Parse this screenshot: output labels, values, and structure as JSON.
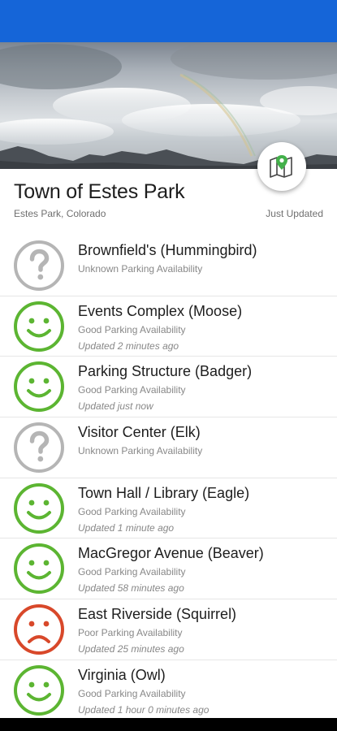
{
  "colors": {
    "status_bar": "#1565d8",
    "good": "#5cb532",
    "poor": "#d8482a",
    "unknown": "#b5b5b5",
    "map_pin": "#43b04a"
  },
  "header": {
    "title": "Town of Estes Park",
    "location": "Estes Park, Colorado",
    "updated": "Just Updated"
  },
  "map_button": {
    "icon": "map-pin-icon"
  },
  "lots": [
    {
      "name": "Brownfield's (Hummingbird)",
      "status": "Unknown Parking Availability",
      "updated": "",
      "state": "unknown"
    },
    {
      "name": "Events Complex (Moose)",
      "status": "Good Parking Availability",
      "updated": "Updated 2 minutes ago",
      "state": "good"
    },
    {
      "name": "Parking Structure (Badger)",
      "status": "Good Parking Availability",
      "updated": "Updated just now",
      "state": "good"
    },
    {
      "name": "Visitor Center (Elk)",
      "status": "Unknown Parking Availability",
      "updated": "",
      "state": "unknown"
    },
    {
      "name": "Town Hall / Library (Eagle)",
      "status": "Good Parking Availability",
      "updated": "Updated 1 minute ago",
      "state": "good"
    },
    {
      "name": "MacGregor Avenue (Beaver)",
      "status": "Good Parking Availability",
      "updated": "Updated 58 minutes ago",
      "state": "good"
    },
    {
      "name": "East Riverside (Squirrel)",
      "status": "Poor Parking Availability",
      "updated": "Updated 25 minutes ago",
      "state": "poor"
    },
    {
      "name": "Virginia (Owl)",
      "status": "Good Parking Availability",
      "updated": "Updated 1 hour 0 minutes ago",
      "state": "good"
    }
  ]
}
